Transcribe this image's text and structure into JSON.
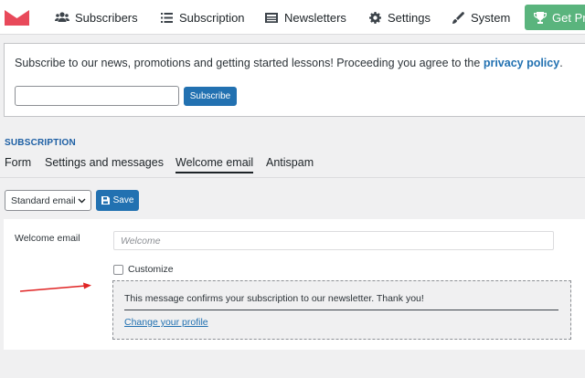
{
  "nav": {
    "items": [
      {
        "label": "Subscribers",
        "icon": "users-icon"
      },
      {
        "label": "Subscription",
        "icon": "list-icon"
      },
      {
        "label": "Newsletters",
        "icon": "newspaper-icon"
      },
      {
        "label": "Settings",
        "icon": "gear-icon"
      },
      {
        "label": "System",
        "icon": "wrench-icon"
      }
    ],
    "get_pro": "Get Pro",
    "logo_color": "#e8495a",
    "get_pro_color": "#5ab47d"
  },
  "notice": {
    "text": "Subscribe to our news, promotions and getting started lessons! Proceeding you agree to the ",
    "link": "privacy policy",
    "suffix": ".",
    "input_value": "",
    "button": "Subscribe"
  },
  "section": {
    "title": "SUBSCRIPTION",
    "tabs": [
      "Form",
      "Settings and messages",
      "Welcome email",
      "Antispam"
    ],
    "active_tab": "Welcome email"
  },
  "toolbar": {
    "select_value": "Standard email",
    "save": "Save"
  },
  "form": {
    "label": "Welcome email",
    "placeholder": "Welcome",
    "checkbox_label": "Customize",
    "checkbox_checked": false,
    "preview_message": "This message confirms your subscription to our newsletter. Thank you!",
    "preview_link": "Change your profile"
  },
  "accent_color": "#2271b1",
  "arrow_color": "#e02424"
}
